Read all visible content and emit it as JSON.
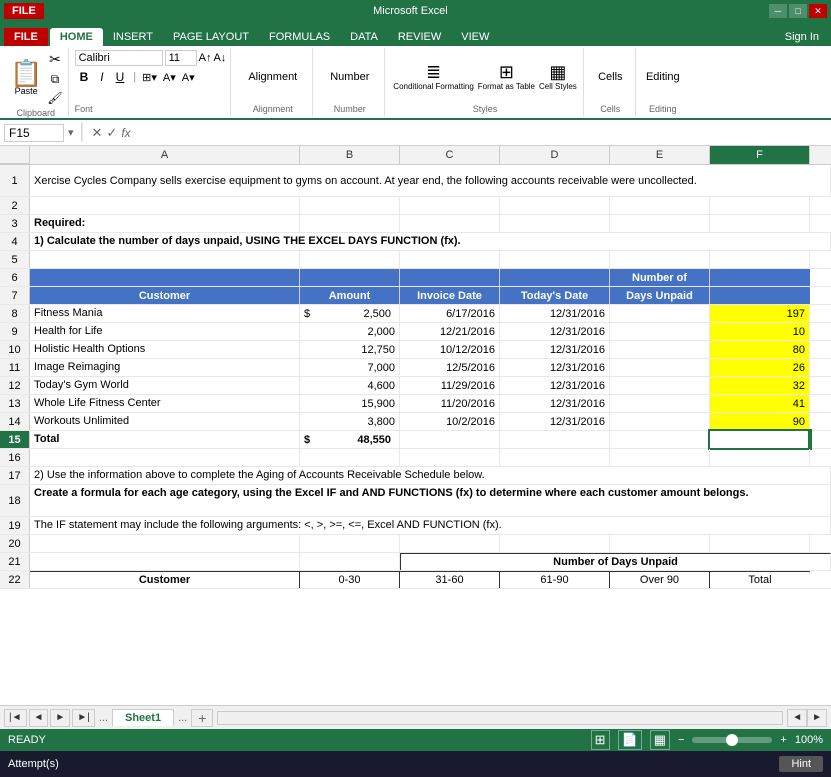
{
  "titleBar": {
    "fileBtn": "FILE",
    "title": "Microsoft Excel",
    "tabs": [
      "HOME",
      "INSERT",
      "PAGE LAYOUT",
      "FORMULAS",
      "DATA",
      "REVIEW",
      "VIEW",
      "Sign In"
    ]
  },
  "ribbon": {
    "activeTab": "HOME",
    "clipboard": {
      "label": "Clipboard",
      "paste": "Paste"
    },
    "font": {
      "label": "Font",
      "name": "Calibri",
      "size": "11"
    },
    "alignment": {
      "label": "Alignment",
      "btn": "Alignment"
    },
    "number": {
      "label": "Number",
      "btn": "Number"
    },
    "styles": {
      "label": "Styles",
      "conditional": "Conditional Formatting",
      "formatAs": "Format as Table",
      "cellStyles": "Cell Styles"
    },
    "cells": {
      "label": "Cells",
      "btn": "Cells"
    },
    "editing": {
      "label": "Editing",
      "btn": "Editing"
    }
  },
  "formulaBar": {
    "cellRef": "F15",
    "formula": ""
  },
  "columns": {
    "headers": [
      "A",
      "B",
      "C",
      "D",
      "E",
      "F"
    ],
    "widths": [
      270,
      100,
      100,
      110,
      110,
      110
    ]
  },
  "rows": [
    {
      "num": 1,
      "cells": [
        {
          "text": "Xercise Cycles Company sells exercise equipment to gyms on account.  At year end, the following accounts receivable were uncollected.",
          "span": 6
        }
      ]
    },
    {
      "num": 2,
      "cells": []
    },
    {
      "num": 3,
      "cells": [
        {
          "text": "Required:",
          "bold": true
        }
      ]
    },
    {
      "num": 4,
      "cells": [
        {
          "text": "1) Calculate the number of days unpaid, USING THE EXCEL DAYS FUNCTION (fx).",
          "bold": true,
          "span": 6
        }
      ]
    },
    {
      "num": 5,
      "cells": []
    },
    {
      "num": 6,
      "cells": [
        {
          "text": "",
          "header": true
        },
        {
          "text": "",
          "header": true
        },
        {
          "text": "",
          "header": true
        },
        {
          "text": "",
          "header": true
        },
        {
          "text": "Number of",
          "header": true,
          "align": "center"
        },
        {
          "text": "",
          "header": true
        }
      ]
    },
    {
      "num": 7,
      "cells": [
        {
          "text": "Customer",
          "header": true,
          "align": "center"
        },
        {
          "text": "Amount",
          "header": true,
          "align": "center"
        },
        {
          "text": "Invoice Date",
          "header": true,
          "align": "center"
        },
        {
          "text": "Today's Date",
          "header": true,
          "align": "center"
        },
        {
          "text": "Days Unpaid",
          "header": true,
          "align": "center"
        },
        {
          "text": "",
          "header": true
        }
      ]
    },
    {
      "num": 8,
      "cells": [
        {
          "text": "Fitness Mania"
        },
        {
          "text": "$     2,500",
          "align": "right"
        },
        {
          "text": "6/17/2016",
          "align": "right"
        },
        {
          "text": "12/31/2016",
          "align": "right"
        },
        {
          "text": ""
        },
        {
          "text": "197",
          "align": "right",
          "yellow": true
        }
      ]
    },
    {
      "num": 9,
      "cells": [
        {
          "text": "Health for Life"
        },
        {
          "text": "2,000",
          "align": "right"
        },
        {
          "text": "12/21/2016",
          "align": "right"
        },
        {
          "text": "12/31/2016",
          "align": "right"
        },
        {
          "text": ""
        },
        {
          "text": "10",
          "align": "right",
          "yellow": true
        }
      ]
    },
    {
      "num": 10,
      "cells": [
        {
          "text": "Holistic Health Options"
        },
        {
          "text": "12,750",
          "align": "right"
        },
        {
          "text": "10/12/2016",
          "align": "right"
        },
        {
          "text": "12/31/2016",
          "align": "right"
        },
        {
          "text": ""
        },
        {
          "text": "80",
          "align": "right",
          "yellow": true
        }
      ]
    },
    {
      "num": 11,
      "cells": [
        {
          "text": "Image Reimaging"
        },
        {
          "text": "7,000",
          "align": "right"
        },
        {
          "text": "12/5/2016",
          "align": "right"
        },
        {
          "text": "12/31/2016",
          "align": "right"
        },
        {
          "text": ""
        },
        {
          "text": "26",
          "align": "right",
          "yellow": true
        }
      ]
    },
    {
      "num": 12,
      "cells": [
        {
          "text": "Today's Gym World"
        },
        {
          "text": "4,600",
          "align": "right"
        },
        {
          "text": "11/29/2016",
          "align": "right"
        },
        {
          "text": "12/31/2016",
          "align": "right"
        },
        {
          "text": ""
        },
        {
          "text": "32",
          "align": "right",
          "yellow": true
        }
      ]
    },
    {
      "num": 13,
      "cells": [
        {
          "text": "Whole Life Fitness Center"
        },
        {
          "text": "15,900",
          "align": "right"
        },
        {
          "text": "11/20/2016",
          "align": "right"
        },
        {
          "text": "12/31/2016",
          "align": "right"
        },
        {
          "text": ""
        },
        {
          "text": "41",
          "align": "right",
          "yellow": true
        }
      ]
    },
    {
      "num": 14,
      "cells": [
        {
          "text": "Workouts Unlimited"
        },
        {
          "text": "3,800",
          "align": "right"
        },
        {
          "text": "10/2/2016",
          "align": "right"
        },
        {
          "text": "12/31/2016",
          "align": "right"
        },
        {
          "text": ""
        },
        {
          "text": "90",
          "align": "right",
          "yellow": true
        }
      ]
    },
    {
      "num": 15,
      "cells": [
        {
          "text": "Total",
          "bold": true
        },
        {
          "text": "$    48,550",
          "align": "right",
          "bold": true,
          "dollar": true
        },
        {
          "text": ""
        },
        {
          "text": ""
        },
        {
          "text": ""
        },
        {
          "text": "",
          "selected": true
        }
      ]
    },
    {
      "num": 16,
      "cells": []
    },
    {
      "num": 17,
      "cells": [
        {
          "text": "2) Use the information above to complete the Aging of Accounts Receivable Schedule below.",
          "span": 6
        }
      ]
    },
    {
      "num": 18,
      "cells": [
        {
          "text": "Create a formula for each age category, using the Excel IF and AND FUNCTIONS (fx) to determine where each customer amount belongs.",
          "span": 6,
          "bold": true
        }
      ]
    },
    {
      "num": 19,
      "cells": [
        {
          "text": "The IF statement may include the following arguments: <, >, >=, <=, Excel AND FUNCTION (fx).",
          "span": 6
        }
      ]
    },
    {
      "num": 20,
      "cells": []
    },
    {
      "num": 21,
      "cells": [
        {
          "text": ""
        },
        {
          "text": ""
        },
        {
          "text": "Number of Days Unpaid",
          "align": "center",
          "span": 4,
          "bold": false
        }
      ]
    },
    {
      "num": 22,
      "cells": [
        {
          "text": "Customer",
          "bold": true,
          "align": "center"
        },
        {
          "text": "0-30",
          "align": "center"
        },
        {
          "text": "31-60",
          "align": "center"
        },
        {
          "text": "61-90",
          "align": "center"
        },
        {
          "text": "Over 90",
          "align": "center"
        },
        {
          "text": "Total",
          "align": "center"
        }
      ]
    }
  ],
  "sheetTabs": {
    "tabs": [
      "Sheet1"
    ],
    "active": "Sheet1"
  },
  "statusBar": {
    "status": "READY",
    "zoom": "100%"
  },
  "attemptBar": {
    "label": "Attempt(s)",
    "hint": "Hint"
  }
}
